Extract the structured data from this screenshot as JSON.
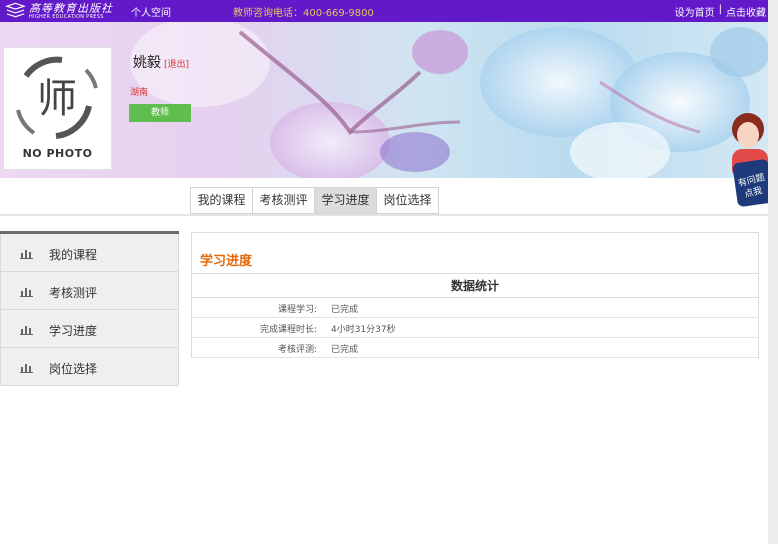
{
  "topbar": {
    "logo_cn": "高等教育出版社",
    "logo_en": "HIGHER EDUCATION PRESS",
    "personal_space": "个人空间",
    "hotline": "教师咨询电话：400-669-9800",
    "set_home": "设为首页",
    "separator": "|",
    "bookmark": "点击收藏"
  },
  "profile": {
    "name": "姚毅",
    "logout": "[退出]",
    "region": "湖南",
    "role": "教师",
    "avatar_text": "NO PHOTO",
    "avatar_glyph": "师"
  },
  "helper": {
    "text_line1": "有问题",
    "text_line2": "点我"
  },
  "tabs": [
    {
      "label": "我的课程",
      "active": false
    },
    {
      "label": "考核测评",
      "active": false
    },
    {
      "label": "学习进度",
      "active": true
    },
    {
      "label": "岗位选择",
      "active": false
    }
  ],
  "sidebar": {
    "icon": "bar-chart-icon",
    "items": [
      {
        "label": "我的课程"
      },
      {
        "label": "考核测评"
      },
      {
        "label": "学习进度"
      },
      {
        "label": "岗位选择"
      }
    ]
  },
  "main": {
    "title": "学习进度",
    "stats_header": "数据统计",
    "rows": [
      {
        "label": "课程学习:",
        "value": "已完成"
      },
      {
        "label": "完成课程时长:",
        "value": "4小时31分37秒"
      },
      {
        "label": "考核评测:",
        "value": "已完成"
      }
    ]
  },
  "colors": {
    "topbar": "#6119c9",
    "hotline": "#e8c35c",
    "accent_orange": "#e36a0c",
    "role_badge": "#5fbe4d",
    "active_tab": "#dcdcdc"
  }
}
